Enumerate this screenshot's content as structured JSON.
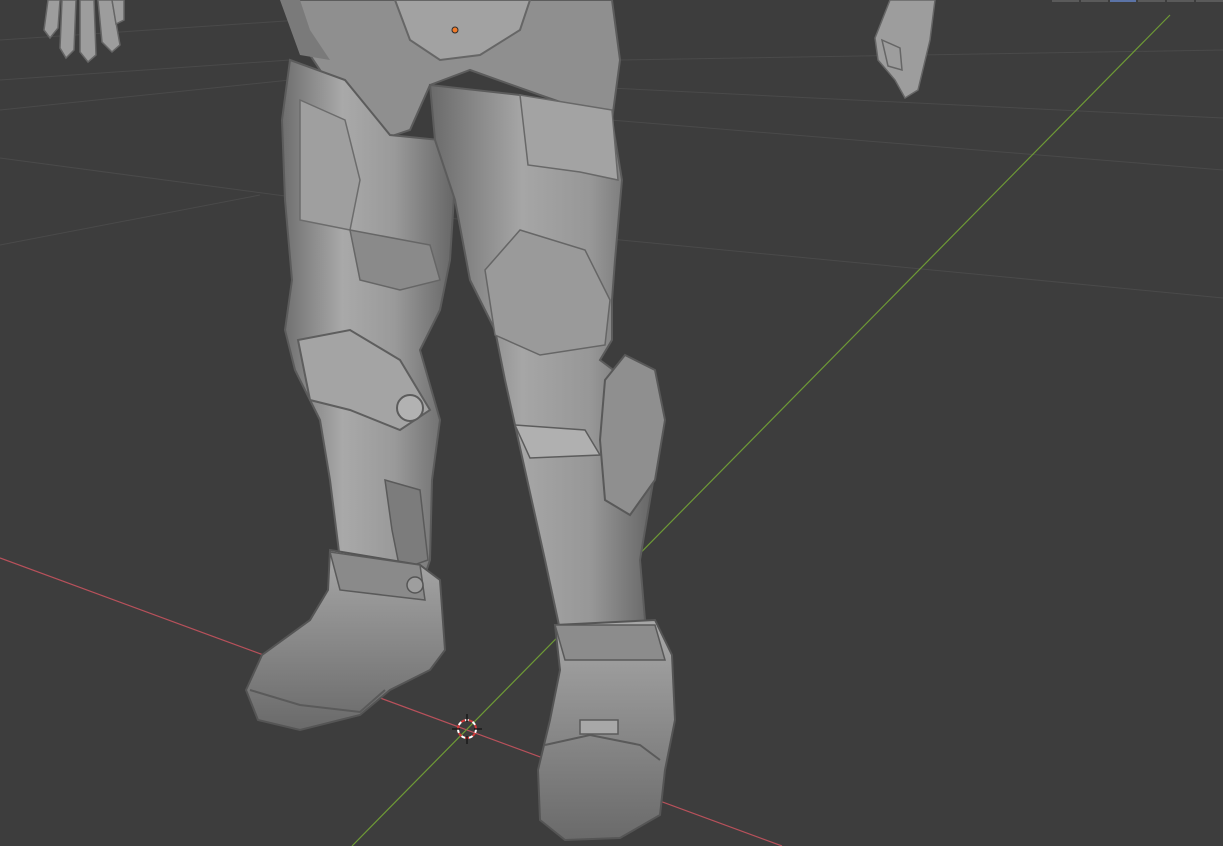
{
  "viewport": {
    "background": "#3d3d3d",
    "grid_color": "#4b4b4b",
    "x_axis_color": "#b8515b",
    "y_axis_color": "#6e9a36",
    "mesh_base_color": "#8c8c8c",
    "mesh_light_color": "#b5b5b5",
    "mesh_dark_color": "#5c5c5c",
    "origin_color": "#f07a2a",
    "cursor_color_a": "#d63a3a",
    "cursor_color_b": "#ffffff",
    "header_tabs": 6,
    "header_active_tab": 2
  }
}
